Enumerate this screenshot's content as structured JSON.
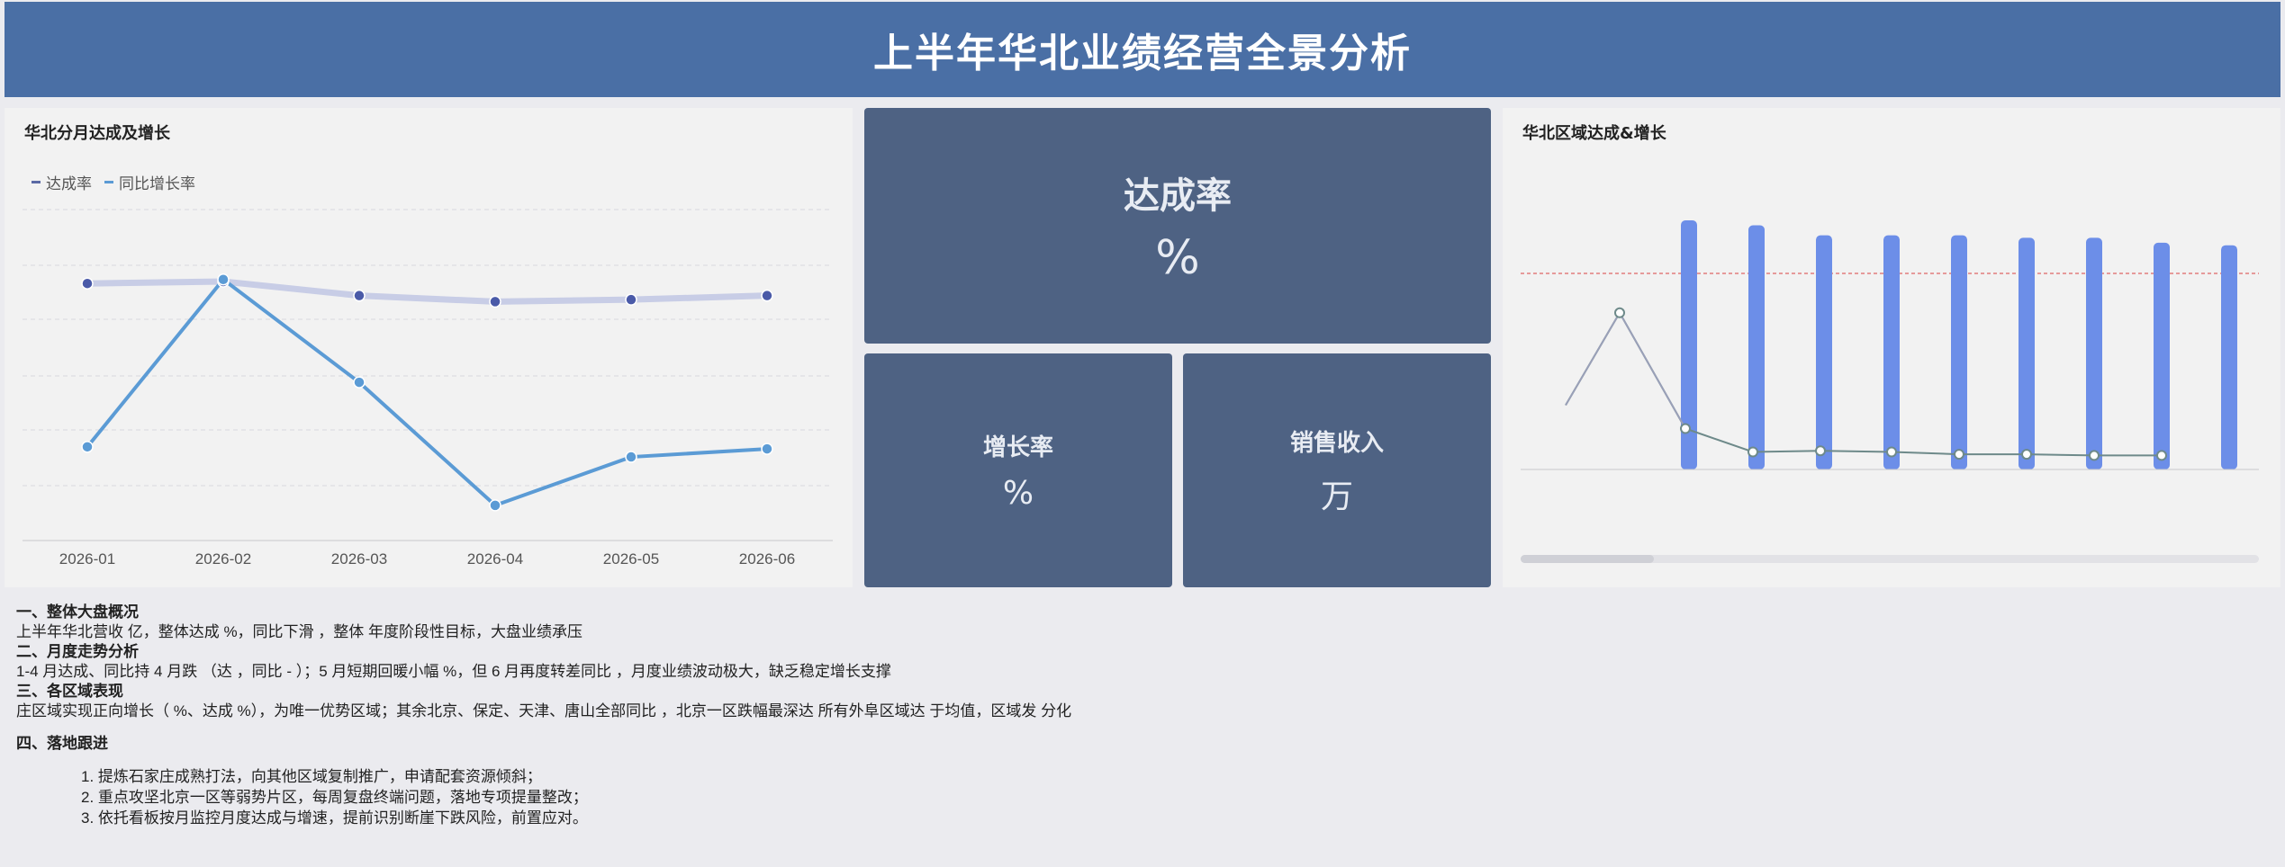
{
  "header": {
    "title": "上半年华北业绩经营全景分析"
  },
  "left_chart": {
    "title": "华北分月达成及增长",
    "legend": [
      {
        "name": "达成率",
        "color": "#5b6aa5"
      },
      {
        "name": "同比增长率",
        "color": "#5b9bd5"
      }
    ]
  },
  "kpis": {
    "main": {
      "label": "达成率",
      "value": "%"
    },
    "growth": {
      "label": "增长率",
      "value": "%"
    },
    "sales": {
      "label": "销售收入",
      "value": "万"
    }
  },
  "right_chart": {
    "title": "华北区域达成&增长"
  },
  "chart_data": [
    {
      "type": "line",
      "title": "华北分月达成及增长",
      "categories": [
        "2026-01",
        "2026-02",
        "2026-03",
        "2026-04",
        "2026-05",
        "2026-06"
      ],
      "series": [
        {
          "name": "达成率",
          "values": [
            0.72,
            0.73,
            0.66,
            0.63,
            0.64,
            0.66
          ]
        },
        {
          "name": "同比增长率",
          "values": [
            -0.09,
            0.74,
            0.23,
            -0.38,
            -0.14,
            -0.1
          ]
        }
      ],
      "ylim": [
        -0.55,
        1.1
      ],
      "grid": true,
      "legend": "top-left"
    },
    {
      "type": "bar",
      "title": "华北区域达成&增长",
      "bar_values": [
        1.0,
        0.98,
        0.94,
        0.94,
        0.94,
        0.93,
        0.93,
        0.91,
        0.9
      ],
      "line_values": [
        1.34,
        0.35,
        0.15,
        0.16,
        0.15,
        0.13,
        0.13,
        0.12,
        0.12
      ],
      "bar_color": "#6c8ee8",
      "line_color": "#6e8a8a",
      "reference_line_color": "#e06666",
      "grid": false
    }
  ],
  "analysis": {
    "s1": {
      "title": "一、整体大盘概况",
      "body": "上半年华北营收 亿，整体达成 %，同比下滑 ，整体 年度阶段性目标，大盘业绩承压"
    },
    "s2": {
      "title": "二、月度走势分析",
      "body": "1-4 月达成、同比持 4 月跌 （达 ，同比 - ）；5 月短期回暖小幅 %，但 6 月再度转差同比 ，月度业绩波动极大，缺乏稳定增长支撑"
    },
    "s3": {
      "title": "三、各区域表现",
      "body": "庄区域实现正向增长（ %、达成 %），为唯一优势区域；其余北京、保定、天津、唐山全部同比 ，北京一区跌幅最深达 所有外阜区域达 于均值，区域发 分化"
    },
    "s4": {
      "title": "四、落地跟进",
      "items": [
        "1. 提炼石家庄成熟打法，向其他区域复制推广，申请配套资源倾斜；",
        "2. 重点攻坚北京一区等弱势片区，每周复盘终端问题，落地专项提量整改；",
        "3. 依托看板按月监控月度达成与增速，提前识别断崖下跌风险，前置应对。"
      ]
    }
  }
}
